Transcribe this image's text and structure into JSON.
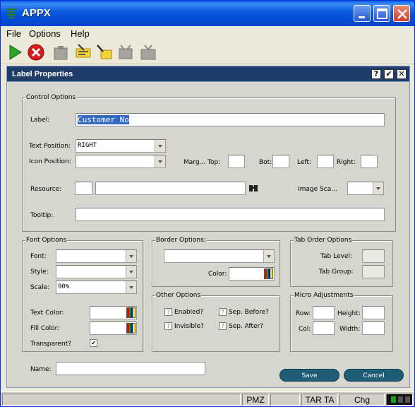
{
  "window": {
    "title": "APPX"
  },
  "menu": {
    "file": "File",
    "options": "Options",
    "help": "Help"
  },
  "toolbar": {
    "items": [
      "play-icon",
      "stop-icon",
      "paste-icon",
      "edit-icon",
      "highlight-icon",
      "clear-icon",
      "tv-icon"
    ]
  },
  "panel": {
    "title": "Label Properties",
    "help": "?",
    "ok": "✔",
    "close": "✕"
  },
  "control": {
    "legend": "Control Options",
    "label_lbl": "Label:",
    "label_val": "Customer No",
    "text_pos_lbl": "Text Position:",
    "text_pos_val": "RIGHT",
    "icon_pos_lbl": "Icon Position:",
    "icon_pos_val": "",
    "marg_top_lbl": "Marg... Top:",
    "bot_lbl": "Bot:",
    "left_lbl": "Left:",
    "right_lbl": "Right:",
    "resource_lbl": "Resource:",
    "image_sca_lbl": "Image Sca...",
    "tooltip_lbl": "Tooltip:"
  },
  "font": {
    "legend": "Font Options",
    "font_lbl": "Font:",
    "style_lbl": "Style:",
    "scale_lbl": "Scale:",
    "scale_val": "90%",
    "text_color_lbl": "Text Color:",
    "fill_color_lbl": "Fill Color:",
    "transparent_lbl": "Transparent?",
    "transparent_val": "✔"
  },
  "border": {
    "legend": "Border Options:",
    "color_lbl": "Color:"
  },
  "tab_order": {
    "legend": "Tab Order Options",
    "level_lbl": "Tab Level:",
    "group_lbl": "Tab Group:"
  },
  "other": {
    "legend": "Other Options",
    "enabled_lbl": "Enabled?",
    "invisible_lbl": "Invisible?",
    "sep_before_lbl": "Sep. Before?",
    "sep_after_lbl": "Sep. After?",
    "unset_mark": "?"
  },
  "micro": {
    "legend": "Micro Adjustments",
    "row_lbl": "Row:",
    "col_lbl": "Col:",
    "height_lbl": "Height:",
    "width_lbl": "Width:"
  },
  "name_lbl": "Name:",
  "buttons": {
    "save": "Save",
    "cancel": "Cancel"
  },
  "status": {
    "pmz": "PMZ",
    "tar": "TAR TA",
    "chg": "Chg"
  },
  "colors": {
    "panel_header": "#1f3d6b",
    "button": "#1f5d77",
    "selection": "#316ac5"
  }
}
